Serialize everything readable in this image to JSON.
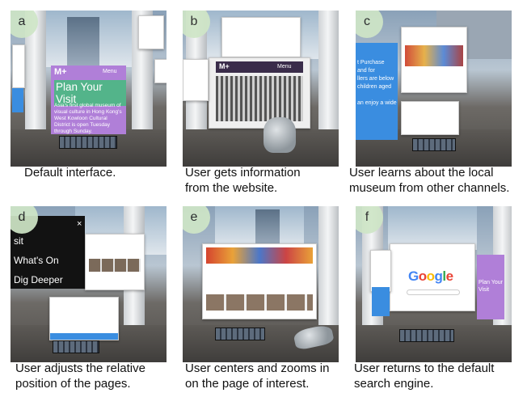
{
  "panels": [
    {
      "badge": "a",
      "caption": "Default interface."
    },
    {
      "badge": "b",
      "caption": "User gets information\nfrom the website."
    },
    {
      "badge": "c",
      "caption": "User learns about the local\nmuseum from other channels."
    },
    {
      "badge": "d",
      "caption": "User adjusts the relative\nposition of the pages."
    },
    {
      "badge": "e",
      "caption": "User centers and zooms in\non the page of interest."
    },
    {
      "badge": "f",
      "caption": "User returns to the default\nsearch engine."
    }
  ],
  "panel_a": {
    "logo": "M+",
    "menu": "Menu",
    "title": "Plan Your Visit",
    "body": "Asia's first global museum of visual culture in Hong Kong's West Kowloon Cultural District is open Tuesday through Sunday."
  },
  "panel_b": {
    "logo": "M+",
    "menu": "Menu"
  },
  "panel_d": {
    "menu_items": [
      "sit",
      "What's On",
      "Dig Deeper"
    ]
  },
  "panel_c": {
    "card_text": "t Purchase\nand for\nllers are below\nchildren aged\n\nan enjoy a wide"
  },
  "panel_f": {
    "google": "Google",
    "side_text": "Plan Your Visit"
  },
  "colors": {
    "google_blue": "#4285F4",
    "google_red": "#EA4335",
    "google_yellow": "#FBBC05",
    "google_green": "#34A853",
    "badge": "#cfe6c7"
  }
}
